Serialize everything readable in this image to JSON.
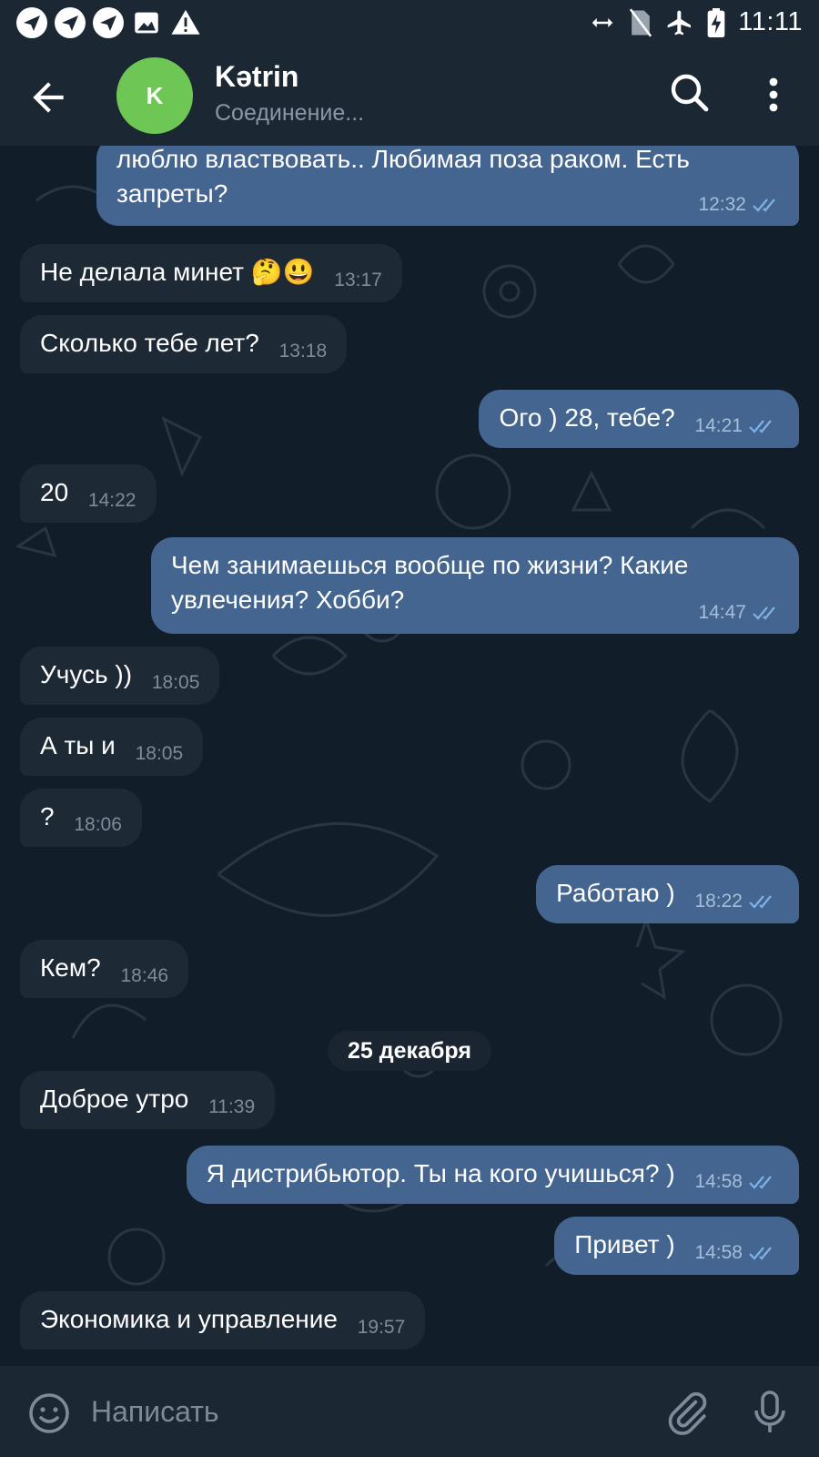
{
  "status_bar": {
    "time": "11:11",
    "left_icons": [
      "app-notification-icon",
      "app-notification-icon",
      "app-notification-icon",
      "image-icon",
      "warning-icon"
    ],
    "right_icons": [
      "data-arrows-icon",
      "no-sim-icon",
      "airplane-icon",
      "battery-charging-icon"
    ]
  },
  "header": {
    "avatar_letter": "K",
    "title": "Kətrin",
    "status": "Соединение...",
    "avatar_color": "#6ec754"
  },
  "messages": [
    {
      "dir": "out",
      "text": "люблю властвовать.. Любимая поза раком. Есть\nзапреты?",
      "time": "12:32",
      "read": true
    },
    {
      "dir": "in",
      "text": "Не делала минет 🤔😃",
      "time": "13:17"
    },
    {
      "dir": "in",
      "text": "Сколько тебе лет?",
      "time": "13:18"
    },
    {
      "dir": "out",
      "text": "Ого ) 28, тебе?",
      "time": "14:21",
      "read": true
    },
    {
      "dir": "in",
      "text": "20",
      "time": "14:22"
    },
    {
      "dir": "out",
      "text": "Чем занимаешься вообще по жизни? Какие\nувлечения? Хобби?",
      "time": "14:47",
      "read": true
    },
    {
      "dir": "in",
      "text": "Учусь ))",
      "time": "18:05"
    },
    {
      "dir": "in",
      "text": "А ты и",
      "time": "18:05"
    },
    {
      "dir": "in",
      "text": "?",
      "time": "18:06"
    },
    {
      "dir": "out",
      "text": "Работаю )",
      "time": "18:22",
      "read": true
    },
    {
      "dir": "in",
      "text": "Кем?",
      "time": "18:46"
    },
    {
      "dir": "in",
      "text": "Доброе утро",
      "time": "11:39"
    },
    {
      "dir": "out",
      "text": "Я дистрибьютор. Ты на кого учишься? )",
      "time": "14:58",
      "read": true
    },
    {
      "dir": "out",
      "text": "Привет )",
      "time": "14:58",
      "read": true
    },
    {
      "dir": "in",
      "text": "Экономика и управление",
      "time": "19:57"
    }
  ],
  "date_separator": "25 декабря",
  "composer": {
    "placeholder": "Написать"
  },
  "colors": {
    "incoming_bubble": "#1e2936",
    "outgoing_bubble": "#44658f",
    "background": "#121d2a",
    "header": "#1c2734"
  }
}
